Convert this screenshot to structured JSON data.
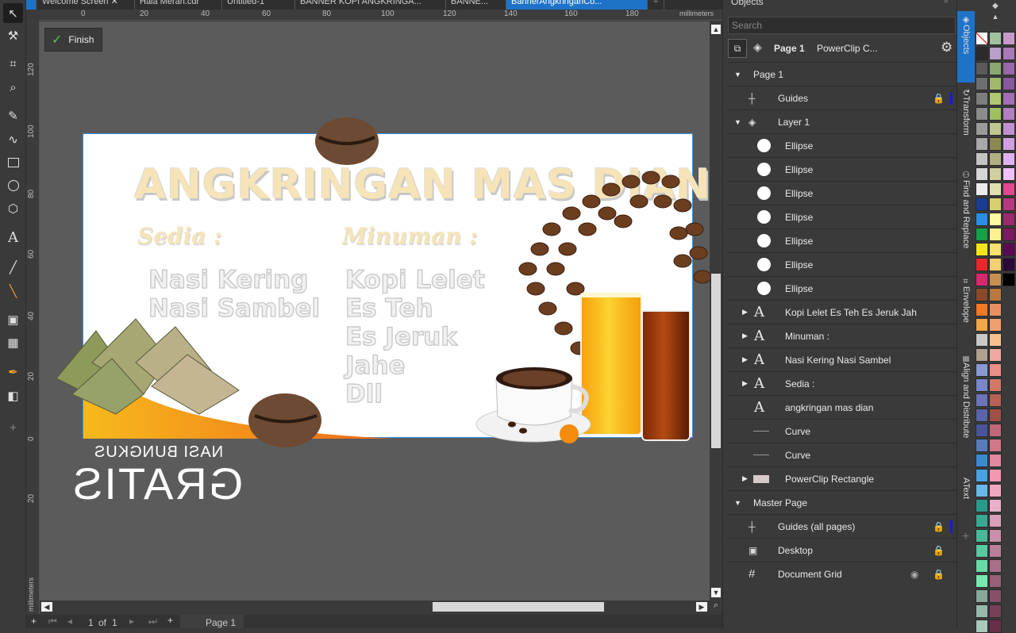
{
  "tabs": [
    {
      "label": "Welcome Screen"
    },
    {
      "label": "Hala Meran.cdr"
    },
    {
      "label": "Untitled-1"
    },
    {
      "label": "BANNER KOPI ANGKRINGA..."
    },
    {
      "label": "BANNE..."
    },
    {
      "label": "BannerAngkringanCo..."
    }
  ],
  "ruler": {
    "unit": "millimeters",
    "h_ticks": [
      "0",
      "20",
      "40",
      "60",
      "80",
      "100",
      "120",
      "140",
      "160",
      "180"
    ],
    "v_ticks": [
      "120",
      "100",
      "80",
      "60",
      "40",
      "20",
      "0",
      "20"
    ]
  },
  "finish_label": "Finish",
  "banner": {
    "title": "ANGKRINGAN MAS DIAN",
    "sedia_heading": "Sedia :",
    "sedia_items": [
      "Nasi Kering",
      "Nasi Sambel"
    ],
    "minuman_heading": "Minuman :",
    "minuman_items": [
      "Kopi Lelet",
      "Es Teh",
      "Es Jeruk",
      "Jahe",
      "Dll"
    ],
    "mirror_small": "NASI BUNGKUS",
    "mirror_big": "GRATIS"
  },
  "status": {
    "page_count": "1",
    "of_label": "of",
    "total_pages": "1",
    "page_tab": "Page 1"
  },
  "objects_panel": {
    "title": "Objects",
    "search_placeholder": "Search",
    "breadcrumb_page": "Page 1",
    "breadcrumb_obj": "PowerClip C...",
    "page_label": "Page 1",
    "guides": "Guides",
    "layer": "Layer 1",
    "ellipses": [
      "Ellipse",
      "Ellipse",
      "Ellipse",
      "Ellipse",
      "Ellipse",
      "Ellipse",
      "Ellipse"
    ],
    "texts": [
      "Kopi Lelet Es Teh Es Jeruk Jah",
      "Minuman :",
      "Nasi Kering Nasi Sambel",
      "Sedia :",
      "angkringan mas dian"
    ],
    "curves": [
      "Curve",
      "Curve"
    ],
    "powerclip": "PowerClip Rectangle",
    "master_page": "Master Page",
    "guides_all": "Guides (all pages)",
    "desktop": "Desktop",
    "document_grid": "Document Grid"
  },
  "docker_tabs": [
    "Objects",
    "Transform",
    "Find and Replace",
    "Envelope",
    "Align and Distribute",
    "Text"
  ],
  "colors": {
    "accent": "#1e73c8",
    "canvas": "#5b5b5b",
    "panel": "#3a3a3a",
    "title_fill": "#f6e4b8"
  }
}
